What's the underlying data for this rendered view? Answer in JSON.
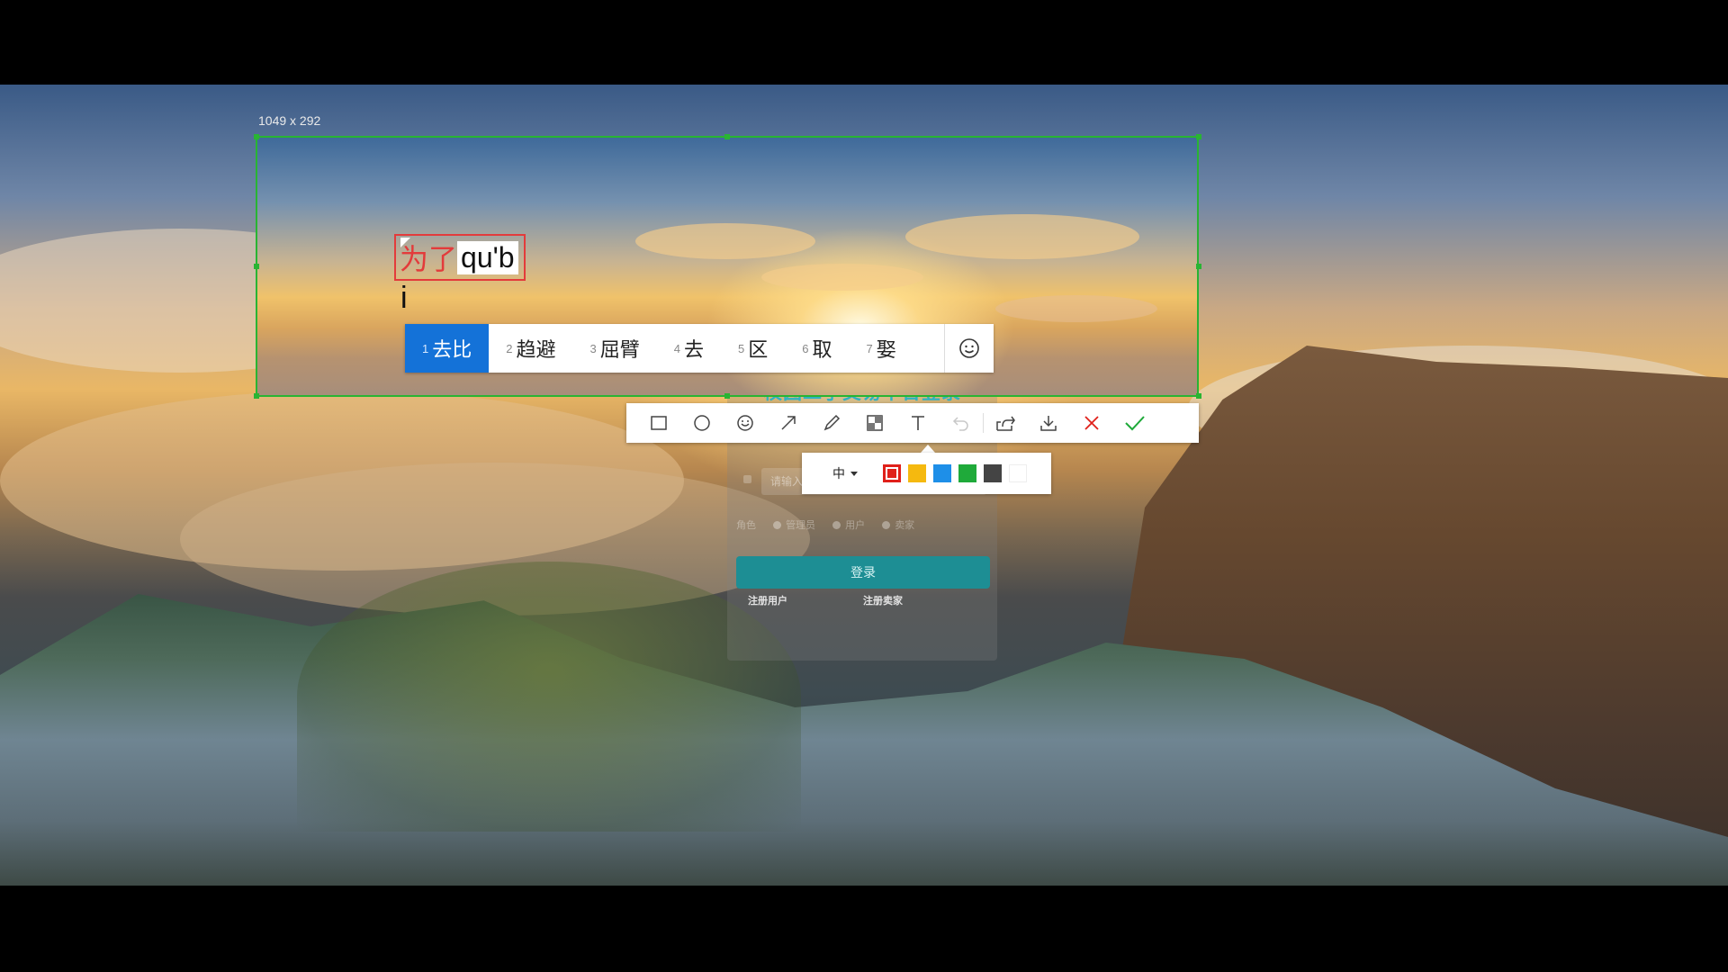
{
  "selection": {
    "size_label": "1049 x 292",
    "border_color": "#29b433"
  },
  "ime": {
    "committed_text": "为了",
    "pinyin": "qu'b",
    "caret_char": "i",
    "candidates": [
      {
        "num": "1",
        "text": "去比",
        "selected": true
      },
      {
        "num": "2",
        "text": "趋避",
        "selected": false
      },
      {
        "num": "3",
        "text": "屈臂",
        "selected": false
      },
      {
        "num": "4",
        "text": "去",
        "selected": false
      },
      {
        "num": "5",
        "text": "区",
        "selected": false
      },
      {
        "num": "6",
        "text": "取",
        "selected": false
      },
      {
        "num": "7",
        "text": "娶",
        "selected": false
      }
    ],
    "emoji_icon": "smiley-icon",
    "highlight_color": "#1472d8"
  },
  "toolbar": {
    "tools": [
      {
        "name": "rectangle-tool",
        "icon": "rectangle-icon"
      },
      {
        "name": "ellipse-tool",
        "icon": "circle-icon"
      },
      {
        "name": "sticker-tool",
        "icon": "smiley-icon"
      },
      {
        "name": "arrow-tool",
        "icon": "arrow-icon"
      },
      {
        "name": "pen-tool",
        "icon": "pen-icon"
      },
      {
        "name": "mosaic-tool",
        "icon": "mosaic-icon"
      },
      {
        "name": "text-tool",
        "icon": "text-icon"
      },
      {
        "name": "undo-button",
        "icon": "undo-icon"
      },
      {
        "name": "share-button",
        "icon": "share-icon"
      },
      {
        "name": "download-button",
        "icon": "download-icon"
      },
      {
        "name": "cancel-button",
        "icon": "close-icon"
      },
      {
        "name": "confirm-button",
        "icon": "check-icon"
      }
    ]
  },
  "text_options": {
    "size_value": "中",
    "colors": [
      "#e0201a",
      "#f5b90f",
      "#1e8fe8",
      "#1faa3a",
      "#444444",
      "#ffffff"
    ],
    "active_color": "#e0201a"
  },
  "background_page": {
    "title": "校园二手交易平台登录",
    "password_placeholder": "请输入",
    "role_label": "角色",
    "roles": [
      "管理员",
      "用户",
      "卖家"
    ],
    "login_button": "登录",
    "register_user": "注册用户",
    "register_seller": "注册卖家",
    "accent": "#1d8e94"
  }
}
